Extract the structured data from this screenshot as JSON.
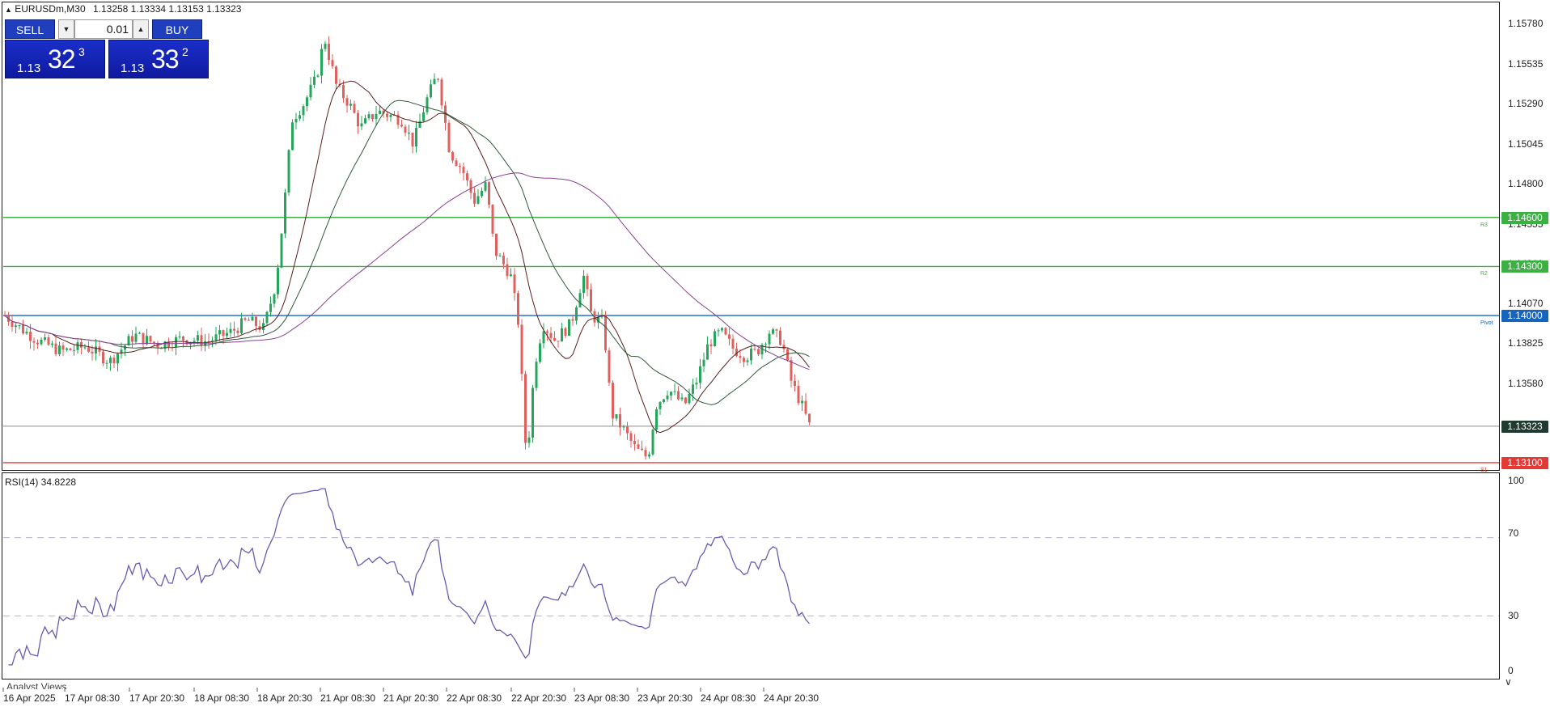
{
  "header": {
    "symbol_timeframe": "EURUSDm,M30",
    "ohlc": "1.13258 1.13334 1.13153 1.13323",
    "collapse_icon": "triangle-up-icon"
  },
  "trade_panel": {
    "sell_label": "SELL",
    "buy_label": "BUY",
    "lot": "0.01",
    "lot_down_icon": "triangle-down-icon",
    "lot_up_icon": "triangle-up-icon",
    "bid": {
      "prefix": "1.13",
      "big": "32",
      "sup": "3"
    },
    "ask": {
      "prefix": "1.13",
      "big": "33",
      "sup": "2"
    }
  },
  "price_axis": {
    "min": 1.1306,
    "max": 1.1591,
    "ticks": [
      "1.15780",
      "1.15535",
      "1.15290",
      "1.15045",
      "1.14800",
      "1.14555",
      "1.14310",
      "1.14070",
      "1.13825",
      "1.13580"
    ]
  },
  "levels": [
    {
      "price": 1.146,
      "label": "1.14600",
      "tag": "R3",
      "color": "#3cb043"
    },
    {
      "price": 1.143,
      "label": "1.14300",
      "tag": "R2",
      "color": "#3cb043"
    },
    {
      "price": 1.14,
      "label": "1.14000",
      "tag": "Pivot",
      "color": "#1565c0"
    },
    {
      "price": 1.131,
      "label": "1.13100",
      "tag": "S1",
      "color": "#e53935"
    }
  ],
  "current_price": {
    "price": 1.13323,
    "label": "1.13323",
    "color": "#1f3b2f"
  },
  "rsi": {
    "title": "RSI(14) 34.8228",
    "levels": [
      "100",
      "70",
      "30",
      "0"
    ],
    "line_color": "#6a5bb0",
    "dash_levels": [
      70,
      30
    ]
  },
  "time_axis": [
    "16 Apr 2025",
    "17 Apr 08:30",
    "17 Apr 20:30",
    "18 Apr 08:30",
    "18 Apr 20:30",
    "21 Apr 08:30",
    "21 Apr 20:30",
    "22 Apr 08:30",
    "22 Apr 20:30",
    "23 Apr 08:30",
    "23 Apr 20:30",
    "24 Apr 08:30",
    "24 Apr 20:30"
  ],
  "analyst_tab": "Analyst Views",
  "candle_colors": {
    "up": "#26a65b",
    "down": "#e0605e"
  },
  "ma_colors": {
    "fast": "#5a1e1e",
    "mid": "#2f5a3a",
    "slow": "#8a3f8f"
  }
}
